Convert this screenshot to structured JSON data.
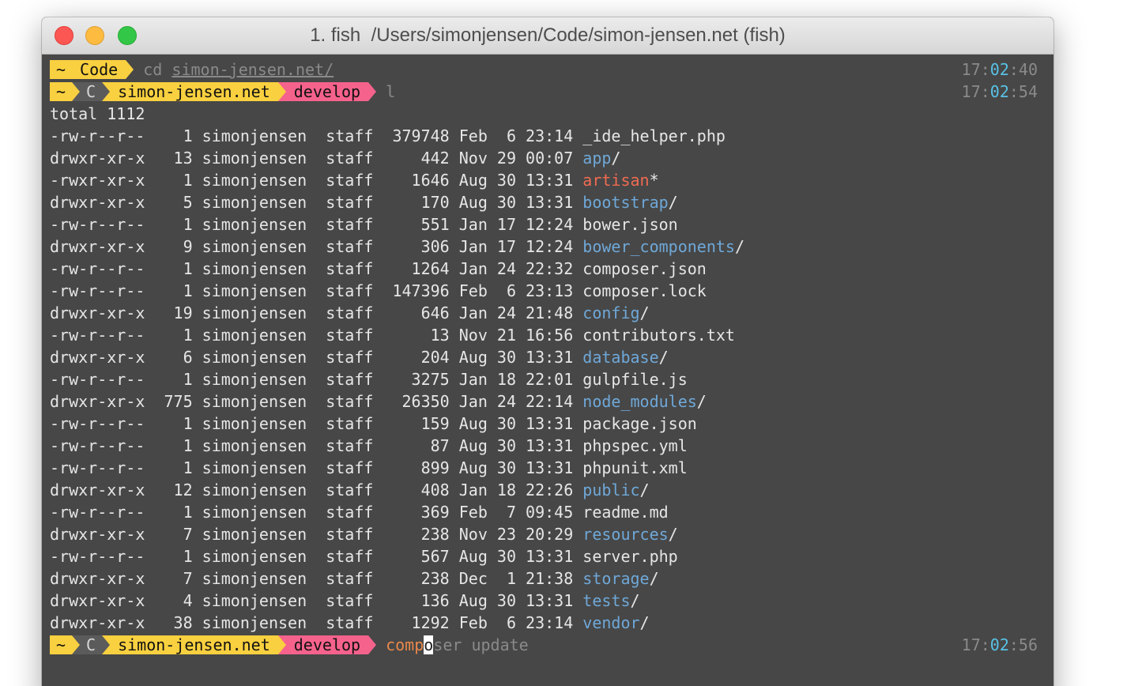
{
  "window": {
    "title": "1. fish  /Users/simonjensen/Code/simon-jensen.net (fish)"
  },
  "prompt1": {
    "tilde": "~",
    "dir": "Code",
    "cmd": "cd",
    "arg": "simon-jensen.net/",
    "time_h": "17:",
    "time_m": "02",
    "time_s": ":40"
  },
  "prompt2": {
    "tilde": "~",
    "c": "C",
    "dir": "simon-jensen.net",
    "branch": "develop",
    "cmd": "l",
    "time_h": "17:",
    "time_m": "02",
    "time_s": ":54"
  },
  "listing": {
    "total": "total 1112",
    "rows": [
      {
        "prefix": "-rw-r--r--    1 simonjensen  staff  379748 Feb  6 23:14 ",
        "name": "_ide_helper.php",
        "kind": "file",
        "suffix": ""
      },
      {
        "prefix": "drwxr-xr-x   13 simonjensen  staff     442 Nov 29 00:07 ",
        "name": "app",
        "kind": "dir",
        "suffix": "/"
      },
      {
        "prefix": "-rwxr-xr-x    1 simonjensen  staff    1646 Aug 30 13:31 ",
        "name": "artisan",
        "kind": "exec",
        "suffix": "*"
      },
      {
        "prefix": "drwxr-xr-x    5 simonjensen  staff     170 Aug 30 13:31 ",
        "name": "bootstrap",
        "kind": "dir",
        "suffix": "/"
      },
      {
        "prefix": "-rw-r--r--    1 simonjensen  staff     551 Jan 17 12:24 ",
        "name": "bower.json",
        "kind": "file",
        "suffix": ""
      },
      {
        "prefix": "drwxr-xr-x    9 simonjensen  staff     306 Jan 17 12:24 ",
        "name": "bower_components",
        "kind": "dir",
        "suffix": "/"
      },
      {
        "prefix": "-rw-r--r--    1 simonjensen  staff    1264 Jan 24 22:32 ",
        "name": "composer.json",
        "kind": "file",
        "suffix": ""
      },
      {
        "prefix": "-rw-r--r--    1 simonjensen  staff  147396 Feb  6 23:13 ",
        "name": "composer.lock",
        "kind": "file",
        "suffix": ""
      },
      {
        "prefix": "drwxr-xr-x   19 simonjensen  staff     646 Jan 24 21:48 ",
        "name": "config",
        "kind": "dir",
        "suffix": "/"
      },
      {
        "prefix": "-rw-r--r--    1 simonjensen  staff      13 Nov 21 16:56 ",
        "name": "contributors.txt",
        "kind": "file",
        "suffix": ""
      },
      {
        "prefix": "drwxr-xr-x    6 simonjensen  staff     204 Aug 30 13:31 ",
        "name": "database",
        "kind": "dir",
        "suffix": "/"
      },
      {
        "prefix": "-rw-r--r--    1 simonjensen  staff    3275 Jan 18 22:01 ",
        "name": "gulpfile.js",
        "kind": "file",
        "suffix": ""
      },
      {
        "prefix": "drwxr-xr-x  775 simonjensen  staff   26350 Jan 24 22:14 ",
        "name": "node_modules",
        "kind": "dir",
        "suffix": "/"
      },
      {
        "prefix": "-rw-r--r--    1 simonjensen  staff     159 Aug 30 13:31 ",
        "name": "package.json",
        "kind": "file",
        "suffix": ""
      },
      {
        "prefix": "-rw-r--r--    1 simonjensen  staff      87 Aug 30 13:31 ",
        "name": "phpspec.yml",
        "kind": "file",
        "suffix": ""
      },
      {
        "prefix": "-rw-r--r--    1 simonjensen  staff     899 Aug 30 13:31 ",
        "name": "phpunit.xml",
        "kind": "file",
        "suffix": ""
      },
      {
        "prefix": "drwxr-xr-x   12 simonjensen  staff     408 Jan 18 22:26 ",
        "name": "public",
        "kind": "dir",
        "suffix": "/"
      },
      {
        "prefix": "-rw-r--r--    1 simonjensen  staff     369 Feb  7 09:45 ",
        "name": "readme.md",
        "kind": "file",
        "suffix": ""
      },
      {
        "prefix": "drwxr-xr-x    7 simonjensen  staff     238 Nov 23 20:29 ",
        "name": "resources",
        "kind": "dir",
        "suffix": "/"
      },
      {
        "prefix": "-rw-r--r--    1 simonjensen  staff     567 Aug 30 13:31 ",
        "name": "server.php",
        "kind": "file",
        "suffix": ""
      },
      {
        "prefix": "drwxr-xr-x    7 simonjensen  staff     238 Dec  1 21:38 ",
        "name": "storage",
        "kind": "dir",
        "suffix": "/"
      },
      {
        "prefix": "drwxr-xr-x    4 simonjensen  staff     136 Aug 30 13:31 ",
        "name": "tests",
        "kind": "dir",
        "suffix": "/"
      },
      {
        "prefix": "drwxr-xr-x   38 simonjensen  staff    1292 Feb  6 23:14 ",
        "name": "vendor",
        "kind": "dir",
        "suffix": "/"
      }
    ]
  },
  "prompt3": {
    "tilde": "~",
    "c": "C",
    "dir": "simon-jensen.net",
    "branch": "develop",
    "typed": "comp",
    "cursor_char": "o",
    "autosuggest": "ser update",
    "time_h": "17:",
    "time_m": "02",
    "time_s": ":56"
  },
  "colors": {
    "terminal_bg": "#474747",
    "prompt_yellow": "#f9d03f",
    "prompt_pink": "#f5628c",
    "prompt_gray": "#5b5b5b",
    "directory": "#6fa8d8",
    "executable": "#ef6b52",
    "time_minutes": "#58c2e6"
  }
}
